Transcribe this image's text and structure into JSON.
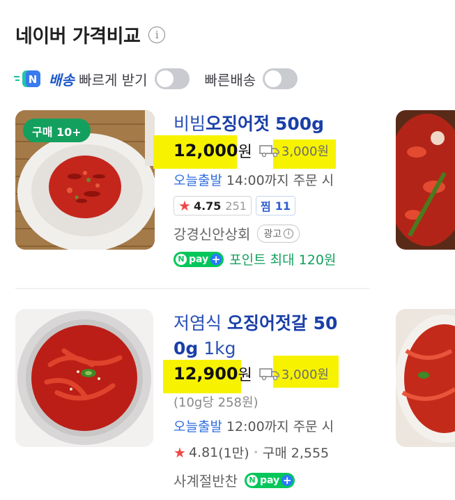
{
  "header": {
    "title": "네이버 가격비교",
    "info_icon": "i"
  },
  "filters": {
    "delivery_brand": "배송",
    "delivery_label": "빠르게 받기",
    "fast_shipping_label": "빠른배송"
  },
  "products": [
    {
      "badge": "구매 10+",
      "title_plain_1": "비빔",
      "title_bold_1": "오징어젓",
      "title_plain_2": "",
      "title_bold_2": "500g",
      "price": "12,000",
      "currency": "원",
      "shipping": "3,000원",
      "dispatch": "오늘출발",
      "dispatch_note": "14:00까지 주문 시",
      "rating": "4.75",
      "review_count": "251",
      "jjim_label": "찜",
      "jjim_count": "11",
      "seller": "강경신안상회",
      "ad_label": "광고",
      "npay_text": "pay",
      "point_text": "포인트 최대 120원"
    },
    {
      "title_plain_1": "저염식 ",
      "title_bold_1": "오징어젓갈 50",
      "title_bold_2": "0g",
      "title_plain_2": " 1kg",
      "price": "12,900",
      "currency": "원",
      "shipping": "3,000원",
      "unit_price": "(10g당 258원)",
      "dispatch": "오늘출발",
      "dispatch_note": "12:00까지 주문 시",
      "rating": "4.81",
      "review_count": "(1만)",
      "separator": "•",
      "purchase_label": "구매 2,555",
      "seller": "사계절반찬",
      "npay_text": "pay"
    }
  ],
  "colors": {
    "highlight": "#f7f300",
    "title_blue": "#2850b4",
    "green": "#13a05e",
    "npay_green": "#03c75a"
  }
}
